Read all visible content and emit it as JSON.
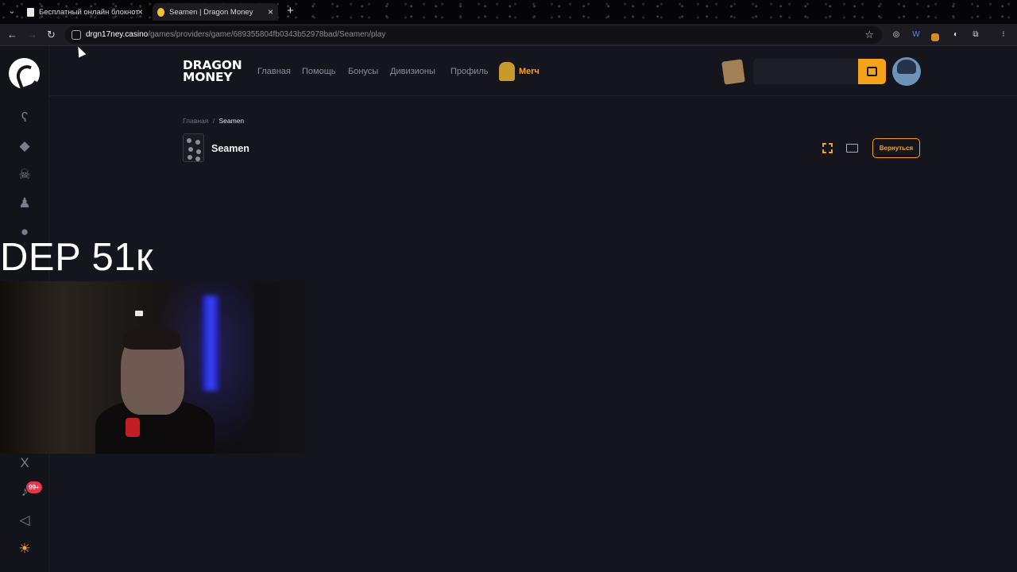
{
  "browser": {
    "tabs": [
      {
        "title": "Бесплатный онлайн блокнот",
        "active": false
      },
      {
        "title": "Seamen | Dragon Money",
        "active": true
      }
    ],
    "url_host": "drgn17ney.casino",
    "url_path": "/games/providers/game/689355804fb0343b52978bad/Seamen/play"
  },
  "site": {
    "logo_line1": "DRAGON",
    "logo_line2": "MONEY",
    "nav": [
      "Главная",
      "Помощь",
      "Бонусы",
      "Дивизионы",
      "Профиль"
    ],
    "merch_label": "Merч",
    "notifications_badge": "99+",
    "accent": "#f7a21b"
  },
  "breadcrumb": {
    "home": "Главная",
    "separator": "/",
    "current": "Seamen"
  },
  "game": {
    "title": "Seamen",
    "back_label": "Вернуться"
  },
  "overlay": {
    "text": "DEP 51к"
  },
  "icons": [
    "bear-icon",
    "ticket-icon",
    "skull-icon",
    "user-icon",
    "fire-icon",
    "twitter-x-icon",
    "bell-icon",
    "mute-icon",
    "sun-icon"
  ]
}
